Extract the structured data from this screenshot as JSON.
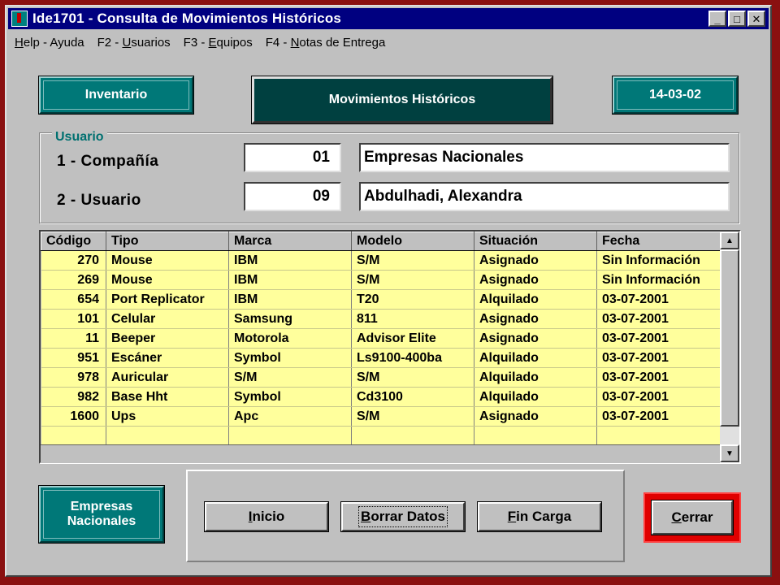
{
  "window": {
    "title": "Ide1701 - Consulta de Movimientos Históricos",
    "controls": {
      "minimize": "_",
      "maximize": "□",
      "close": "✕"
    }
  },
  "menu": {
    "items": [
      {
        "pre": "",
        "hot": "H",
        "post": "elp - Ayuda"
      },
      {
        "pre": "F2 - ",
        "hot": "U",
        "post": "suarios"
      },
      {
        "pre": "F3 - ",
        "hot": "E",
        "post": "quipos"
      },
      {
        "pre": "F4 - ",
        "hot": "N",
        "post": "otas de Entrega"
      }
    ]
  },
  "header": {
    "left": "Inventario",
    "center": "Movimientos Históricos",
    "right": "14-03-02"
  },
  "user_group": {
    "legend": "Usuario",
    "company_label": "1 - Compañía",
    "company_code": "01",
    "company_name": "Empresas Nacionales",
    "user_label": "2 - Usuario",
    "user_code": "09",
    "user_name": "Abdulhadi, Alexandra"
  },
  "grid": {
    "columns": [
      "Código",
      "Tipo",
      "Marca",
      "Modelo",
      "Situación",
      "Fecha"
    ],
    "rows": [
      [
        "270",
        "Mouse",
        "IBM",
        "S/M",
        "Asignado",
        "Sin Información"
      ],
      [
        "269",
        "Mouse",
        "IBM",
        "S/M",
        "Asignado",
        "Sin Información"
      ],
      [
        "654",
        "Port Replicator",
        "IBM",
        "T20",
        "Alquilado",
        "03-07-2001"
      ],
      [
        "101",
        "Celular",
        "Samsung",
        "811",
        "Asignado",
        "03-07-2001"
      ],
      [
        "11",
        "Beeper",
        "Motorola",
        "Advisor Elite",
        "Asignado",
        "03-07-2001"
      ],
      [
        "951",
        "Escáner",
        "Symbol",
        "Ls9100-400ba",
        "Alquilado",
        "03-07-2001"
      ],
      [
        "978",
        "Auricular",
        "S/M",
        "S/M",
        "Alquilado",
        "03-07-2001"
      ],
      [
        "982",
        "Base Hht",
        "Symbol",
        "Cd3100",
        "Alquilado",
        "03-07-2001"
      ],
      [
        "1600",
        "Ups",
        "Apc",
        "S/M",
        "Asignado",
        "03-07-2001"
      ]
    ],
    "scroll_up": "▲",
    "scroll_down": "▼"
  },
  "footer": {
    "company_badge_line1": "Empresas",
    "company_badge_line2": "Nacionales",
    "buttons": [
      {
        "hot": "I",
        "post": "nicio"
      },
      {
        "hot": "B",
        "post": "orrar Datos"
      },
      {
        "hot": "F",
        "post": "in Carga"
      }
    ],
    "close": {
      "hot": "C",
      "post": "errar"
    }
  },
  "colors": {
    "teal": "#007878",
    "dark_teal": "#004040",
    "grid_row": "#ffff9c",
    "title_bar": "#000080",
    "accent_red": "#e00000"
  }
}
